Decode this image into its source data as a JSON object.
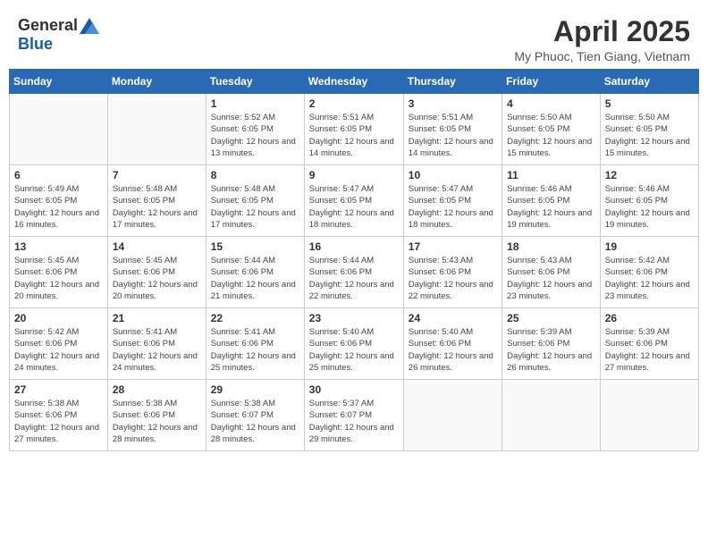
{
  "header": {
    "logo_general": "General",
    "logo_blue": "Blue",
    "title": "April 2025",
    "location": "My Phuoc, Tien Giang, Vietnam"
  },
  "weekdays": [
    "Sunday",
    "Monday",
    "Tuesday",
    "Wednesday",
    "Thursday",
    "Friday",
    "Saturday"
  ],
  "weeks": [
    [
      {
        "day": "",
        "info": ""
      },
      {
        "day": "",
        "info": ""
      },
      {
        "day": "1",
        "info": "Sunrise: 5:52 AM\nSunset: 6:05 PM\nDaylight: 12 hours and 13 minutes."
      },
      {
        "day": "2",
        "info": "Sunrise: 5:51 AM\nSunset: 6:05 PM\nDaylight: 12 hours and 14 minutes."
      },
      {
        "day": "3",
        "info": "Sunrise: 5:51 AM\nSunset: 6:05 PM\nDaylight: 12 hours and 14 minutes."
      },
      {
        "day": "4",
        "info": "Sunrise: 5:50 AM\nSunset: 6:05 PM\nDaylight: 12 hours and 15 minutes."
      },
      {
        "day": "5",
        "info": "Sunrise: 5:50 AM\nSunset: 6:05 PM\nDaylight: 12 hours and 15 minutes."
      }
    ],
    [
      {
        "day": "6",
        "info": "Sunrise: 5:49 AM\nSunset: 6:05 PM\nDaylight: 12 hours and 16 minutes."
      },
      {
        "day": "7",
        "info": "Sunrise: 5:48 AM\nSunset: 6:05 PM\nDaylight: 12 hours and 17 minutes."
      },
      {
        "day": "8",
        "info": "Sunrise: 5:48 AM\nSunset: 6:05 PM\nDaylight: 12 hours and 17 minutes."
      },
      {
        "day": "9",
        "info": "Sunrise: 5:47 AM\nSunset: 6:05 PM\nDaylight: 12 hours and 18 minutes."
      },
      {
        "day": "10",
        "info": "Sunrise: 5:47 AM\nSunset: 6:05 PM\nDaylight: 12 hours and 18 minutes."
      },
      {
        "day": "11",
        "info": "Sunrise: 5:46 AM\nSunset: 6:05 PM\nDaylight: 12 hours and 19 minutes."
      },
      {
        "day": "12",
        "info": "Sunrise: 5:46 AM\nSunset: 6:05 PM\nDaylight: 12 hours and 19 minutes."
      }
    ],
    [
      {
        "day": "13",
        "info": "Sunrise: 5:45 AM\nSunset: 6:06 PM\nDaylight: 12 hours and 20 minutes."
      },
      {
        "day": "14",
        "info": "Sunrise: 5:45 AM\nSunset: 6:06 PM\nDaylight: 12 hours and 20 minutes."
      },
      {
        "day": "15",
        "info": "Sunrise: 5:44 AM\nSunset: 6:06 PM\nDaylight: 12 hours and 21 minutes."
      },
      {
        "day": "16",
        "info": "Sunrise: 5:44 AM\nSunset: 6:06 PM\nDaylight: 12 hours and 22 minutes."
      },
      {
        "day": "17",
        "info": "Sunrise: 5:43 AM\nSunset: 6:06 PM\nDaylight: 12 hours and 22 minutes."
      },
      {
        "day": "18",
        "info": "Sunrise: 5:43 AM\nSunset: 6:06 PM\nDaylight: 12 hours and 23 minutes."
      },
      {
        "day": "19",
        "info": "Sunrise: 5:42 AM\nSunset: 6:06 PM\nDaylight: 12 hours and 23 minutes."
      }
    ],
    [
      {
        "day": "20",
        "info": "Sunrise: 5:42 AM\nSunset: 6:06 PM\nDaylight: 12 hours and 24 minutes."
      },
      {
        "day": "21",
        "info": "Sunrise: 5:41 AM\nSunset: 6:06 PM\nDaylight: 12 hours and 24 minutes."
      },
      {
        "day": "22",
        "info": "Sunrise: 5:41 AM\nSunset: 6:06 PM\nDaylight: 12 hours and 25 minutes."
      },
      {
        "day": "23",
        "info": "Sunrise: 5:40 AM\nSunset: 6:06 PM\nDaylight: 12 hours and 25 minutes."
      },
      {
        "day": "24",
        "info": "Sunrise: 5:40 AM\nSunset: 6:06 PM\nDaylight: 12 hours and 26 minutes."
      },
      {
        "day": "25",
        "info": "Sunrise: 5:39 AM\nSunset: 6:06 PM\nDaylight: 12 hours and 26 minutes."
      },
      {
        "day": "26",
        "info": "Sunrise: 5:39 AM\nSunset: 6:06 PM\nDaylight: 12 hours and 27 minutes."
      }
    ],
    [
      {
        "day": "27",
        "info": "Sunrise: 5:38 AM\nSunset: 6:06 PM\nDaylight: 12 hours and 27 minutes."
      },
      {
        "day": "28",
        "info": "Sunrise: 5:38 AM\nSunset: 6:06 PM\nDaylight: 12 hours and 28 minutes."
      },
      {
        "day": "29",
        "info": "Sunrise: 5:38 AM\nSunset: 6:07 PM\nDaylight: 12 hours and 28 minutes."
      },
      {
        "day": "30",
        "info": "Sunrise: 5:37 AM\nSunset: 6:07 PM\nDaylight: 12 hours and 29 minutes."
      },
      {
        "day": "",
        "info": ""
      },
      {
        "day": "",
        "info": ""
      },
      {
        "day": "",
        "info": ""
      }
    ]
  ]
}
